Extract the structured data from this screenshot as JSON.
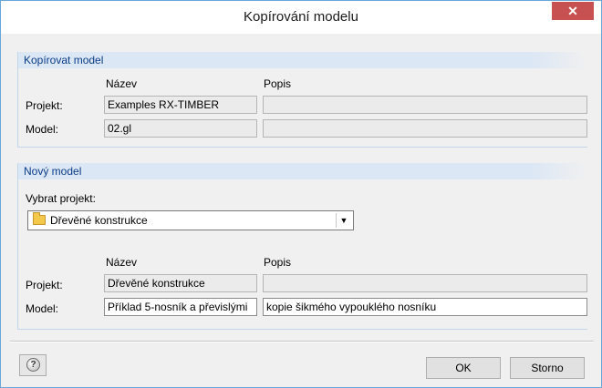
{
  "window": {
    "title": "Kopírování modelu",
    "close_glyph": "✕"
  },
  "copy_group": {
    "heading": "Kopírovat model",
    "col_name": "Název",
    "col_desc": "Popis",
    "project_label": "Projekt:",
    "project_name": "Examples RX-TIMBER",
    "project_desc": "",
    "model_label": "Model:",
    "model_name": "02.gl",
    "model_desc": ""
  },
  "new_group": {
    "heading": "Nový model",
    "select_project_label": "Vybrat projekt:",
    "selected_project": "Dřevěné konstrukce",
    "col_name": "Název",
    "col_desc": "Popis",
    "project_label": "Projekt:",
    "project_name": "Dřevěné konstrukce",
    "project_desc": "",
    "model_label": "Model:",
    "model_name": "Příklad 5-nosník a převislými",
    "model_desc": "kopie šikmého vypouklého nosníku"
  },
  "footer": {
    "help_glyph": "?",
    "ok_label": "OK",
    "cancel_label": "Storno"
  },
  "icons": [
    "close-icon",
    "folder-icon",
    "dropdown-arrow-icon",
    "help-icon"
  ]
}
